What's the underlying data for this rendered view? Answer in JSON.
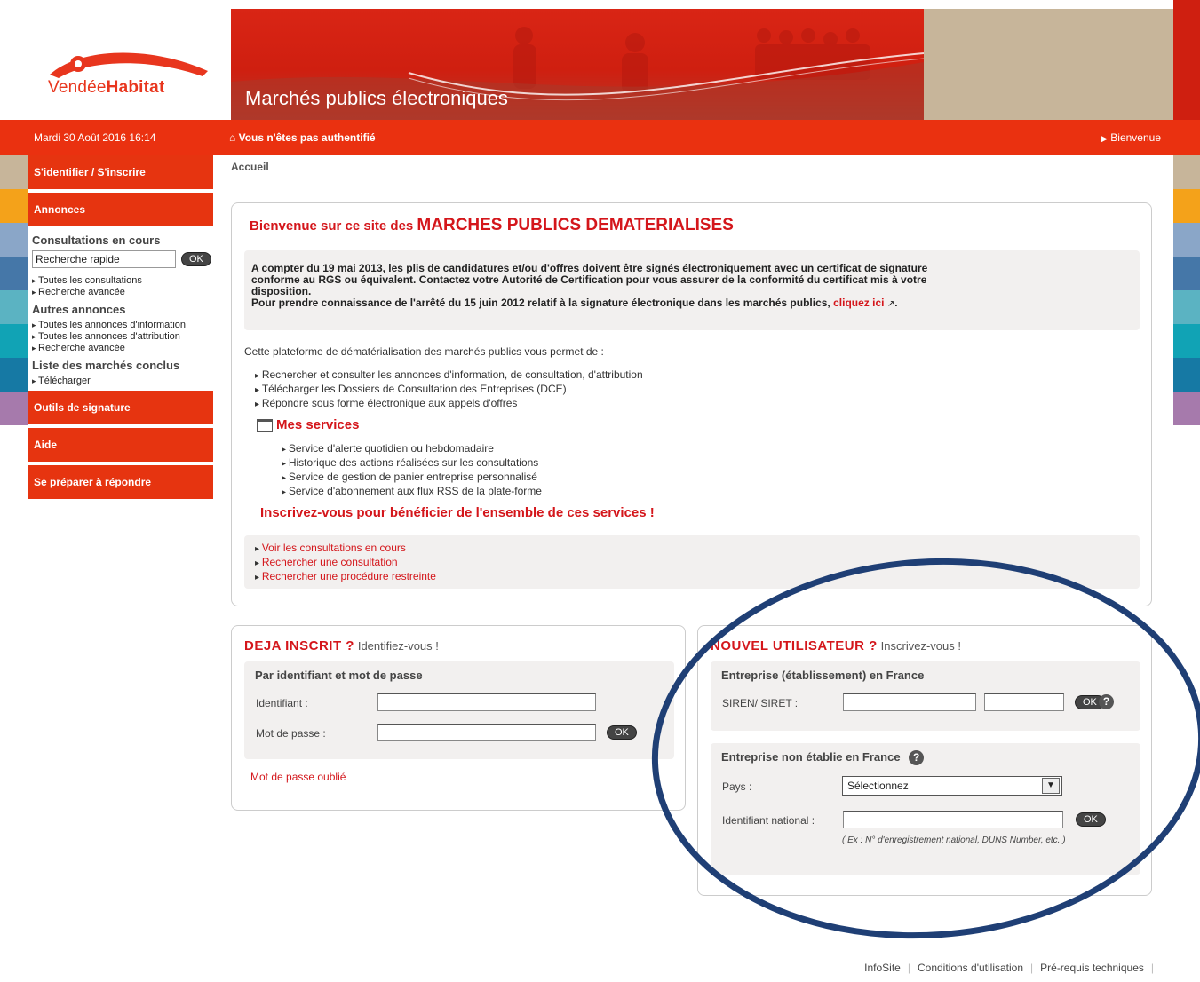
{
  "header": {
    "logo_text_light": "Vendée",
    "logo_text_bold": "Habitat",
    "banner_title": "Marchés publics électroniques"
  },
  "topbar": {
    "date": "Mardi 30 Août 2016 16:14",
    "auth_status": "Vous n'êtes pas authentifié",
    "welcome_link": "Bienvenue"
  },
  "menu": {
    "identify": "S'identifier / S'inscrire",
    "annonces": "Annonces",
    "consultations_title": "Consultations en cours",
    "quick_search_value": "Recherche rapide",
    "ok": "OK",
    "all_consultations": "Toutes les consultations",
    "advanced_search": "Recherche avancée",
    "other_title": "Autres annonces",
    "all_info": "Toutes les annonces d'information",
    "all_attr": "Toutes les annonces d'attribution",
    "advanced_search_2": "Recherche avancée",
    "concluded_title": "Liste des marchés conclus",
    "download": "Télécharger",
    "signature_tools": "Outils de signature",
    "help": "Aide",
    "prepare": "Se préparer à répondre"
  },
  "breadcrumb": "Accueil",
  "welcome": {
    "title_prefix": "Bienvenue sur ce site des",
    "title_big": "MARCHES PUBLICS DEMATERIALISES",
    "notice_line1": "A compter du 19 mai 2013, les plis de candidatures et/ou d'offres doivent être signés électroniquement avec un certificat de signature",
    "notice_line2": "conforme au RGS ou équivalent. Contactez votre Autorité de Certification pour vous assurer de la conformité du certificat mis à votre",
    "notice_line3": "disposition.",
    "notice_line4": "Pour prendre connaissance de l'arrêté du 15 juin 2012 relatif à la signature électronique dans les marchés publics,",
    "notice_link": "cliquez ici",
    "intro": "Cette plateforme de dématérialisation des marchés publics vous permet de :",
    "bullets": [
      "Rechercher et consulter les annonces d'information, de consultation, d'attribution",
      "Télécharger les Dossiers de Consultation des Entreprises (DCE)",
      "Répondre sous forme électronique aux appels d'offres"
    ],
    "services_title": "Mes services",
    "services": [
      "Service d'alerte quotidien ou hebdomadaire",
      "Historique des actions réalisées sur les consultations",
      "Service de gestion de panier entreprise personnalisé",
      "Service d'abonnement aux flux RSS de la plate-forme"
    ],
    "signup_cta": "Inscrivez-vous pour bénéficier de l'ensemble de ces services !",
    "links": [
      "Voir les consultations en cours",
      "Rechercher une consultation",
      "Rechercher une procédure restreinte"
    ]
  },
  "login": {
    "title": "DEJA INSCRIT ?",
    "subtitle": "Identifiez-vous !",
    "section": "Par identifiant et mot de passe",
    "id_label": "Identifiant :",
    "pw_label": "Mot de passe :",
    "ok": "OK",
    "forgot": "Mot de passe oublié"
  },
  "new_user": {
    "title": "NOUVEL UTILISATEUR ?",
    "subtitle": "Inscrivez-vous !",
    "fr_section": "Entreprise (établissement) en France",
    "siren_label": "SIREN/ SIRET :",
    "ok": "OK",
    "help": "?",
    "foreign_section": "Entreprise non établie en France",
    "country_label": "Pays :",
    "country_selected": "Sélectionnez",
    "national_id_label": "Identifiant national :",
    "example": "( Ex : N° d'enregistrement national, DUNS Number, etc. )"
  },
  "footer": {
    "infosite": "InfoSite",
    "terms": "Conditions d'utilisation",
    "prereq": "Pré-requis techniques"
  },
  "colors": {
    "brand_red": "#e63410",
    "title_red": "#d4161b",
    "ellipse_blue": "#1f3f75"
  }
}
